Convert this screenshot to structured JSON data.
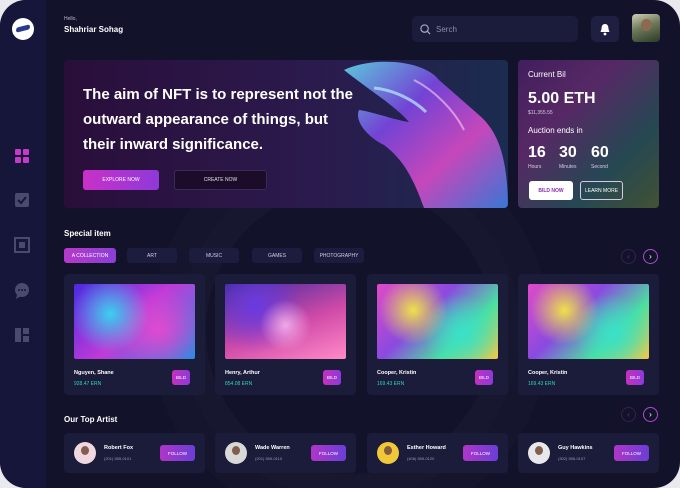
{
  "header": {
    "greeting": "Hello,",
    "user_name": "Shahriar Sohag",
    "search_placeholder": "Serch"
  },
  "sidebar": {
    "icons": [
      "dashboard-icon",
      "checkbox-icon",
      "frame-icon",
      "chat-icon",
      "layout-icon"
    ],
    "active_index": 0
  },
  "hero": {
    "headline": "The aim of NFT is to represent not the outward appearance of things, but their inward significance.",
    "explore_label": "EXPLORE NOW",
    "create_label": "CREATE NOW"
  },
  "bid_panel": {
    "title": "Current Bil",
    "amount": "5.00 ETH",
    "usd": "$11,355.55",
    "auction_label": "Auction ends in",
    "countdown": [
      {
        "value": "16",
        "unit": "Hours"
      },
      {
        "value": "30",
        "unit": "Minutes"
      },
      {
        "value": "60",
        "unit": "Second"
      }
    ],
    "bid_label": "BILD NOW",
    "learn_label": "LEARN MORE"
  },
  "special": {
    "title": "Special item",
    "filters": [
      "A COLLECTION",
      "ART",
      "MUSIC",
      "GAMES",
      "PHOTOGRAPHY"
    ],
    "active_filter": 0,
    "items": [
      {
        "name": "Nguyen, Shane",
        "price": "928.47 ERN",
        "price_color": "#2fd6b5",
        "bid_label": "BILD"
      },
      {
        "name": "Henry, Arthur",
        "price": "854.08 ERN",
        "price_color": "#2fd6b5",
        "bid_label": "BILD"
      },
      {
        "name": "Cooper, Kristin",
        "price": "169.43 ERN",
        "price_color": "#2fd6b5",
        "bid_label": "BILD"
      },
      {
        "name": "Cooper, Kristin",
        "price": "169.43 ERN",
        "price_color": "#2fd6b5",
        "bid_label": "BILD"
      }
    ]
  },
  "artists": {
    "title": "Our Top Artist",
    "items": [
      {
        "name": "Robert Fox",
        "phone": "(201) 555-0101",
        "follow_label": "FOLLOW"
      },
      {
        "name": "Wade Warren",
        "phone": "(201) 555-0110",
        "follow_label": "FOLLOW"
      },
      {
        "name": "Esther Howard",
        "phone": "(406) 555-0120",
        "follow_label": "FOLLOW"
      },
      {
        "name": "Guy Hawkins",
        "phone": "(302) 555-0107",
        "follow_label": "FOLLOW"
      }
    ]
  },
  "colors": {
    "background": "#12122a",
    "sidebar": "#16163a",
    "card": "#1b1b3a",
    "accent_start": "#c931c9",
    "accent_end": "#8e39d9",
    "price": "#2fd6b5"
  }
}
